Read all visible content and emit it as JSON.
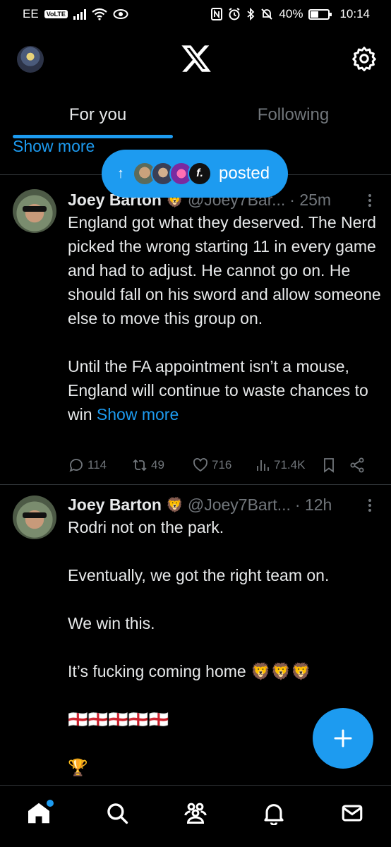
{
  "status_bar": {
    "carrier": "EE",
    "volte": "VoLTE",
    "battery": "40%",
    "time": "10:14"
  },
  "header": {
    "logo": "X"
  },
  "tabs": [
    {
      "label": "For you",
      "active": true
    },
    {
      "label": "Following",
      "active": false
    }
  ],
  "previous_post": {
    "show_more": "Show more"
  },
  "posted_pill": {
    "text": "posted",
    "avatar4": "f."
  },
  "tweets": [
    {
      "name": "Joey Barton",
      "badge": "🦁",
      "handle": "@Joey7Bar...",
      "time": "· 25m",
      "body": "England got what they deserved. The Nerd picked the wrong starting 11 in every game and had to adjust. He cannot go on. He should fall on his sword and allow someone else to move this group on.\n\nUntil the FA appointment isn’t a mouse, England will continue to waste chances to win",
      "show_more": "Show more",
      "replies": "114",
      "reposts": "49",
      "likes": "716",
      "views": "71.4K"
    },
    {
      "name": "Joey Barton",
      "badge": "🦁",
      "handle": "@Joey7Bart...",
      "time": "· 12h",
      "body": "Rodri not on the park.\n\nEventually, we got the right team on.\n\nWe win this.\n\nIt’s fucking coming home 🦁🦁🦁\n\n🏴󠁧󠁢󠁥󠁮󠁧󠁿🏴󠁧󠁢󠁥󠁮󠁧󠁿🏴󠁧󠁢󠁥󠁮󠁧󠁿🏴󠁧󠁢󠁥󠁮󠁧󠁿🏴󠁧󠁢󠁥󠁮󠁧󠁿\n\n🏆"
    }
  ],
  "colors": {
    "accent": "#1d9bf0",
    "background": "#000000",
    "muted": "#71767b",
    "text": "#e7e9ea"
  },
  "icons": [
    "home-icon",
    "search-icon",
    "communities-icon",
    "notifications-icon",
    "messages-icon",
    "settings-icon",
    "x-logo-icon",
    "compose-icon"
  ]
}
